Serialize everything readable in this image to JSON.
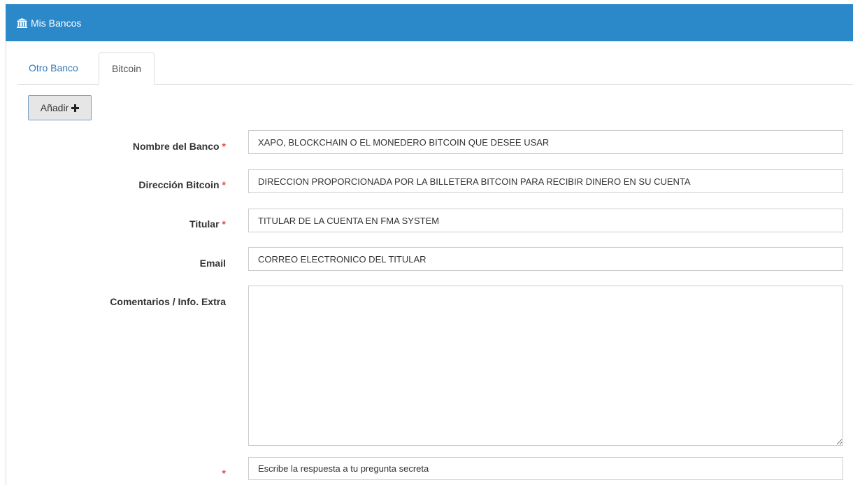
{
  "header": {
    "icon": "bank-icon",
    "title": "Mis Bancos"
  },
  "tabs": [
    {
      "label": "Otro Banco",
      "active": false
    },
    {
      "label": "Bitcoin",
      "active": true
    }
  ],
  "toolbar": {
    "add_label": "Añadir",
    "add_icon": "plus-icon"
  },
  "form": {
    "bank_name": {
      "label": "Nombre del Banco",
      "required": "*",
      "value": "XAPO, BLOCKCHAIN O EL MONEDERO BITCOIN QUE DESEE USAR"
    },
    "bitcoin_address": {
      "label": "Dirección Bitcoin",
      "required": "*",
      "value": "DIRECCION PROPORCIONADA POR LA BILLETERA BITCOIN PARA RECIBIR DINERO EN SU CUENTA"
    },
    "holder": {
      "label": "Titular",
      "required": "*",
      "value": "TITULAR DE LA CUENTA EN FMA SYSTEM"
    },
    "email": {
      "label": "Email",
      "value": "CORREO ELECTRONICO DEL TITULAR"
    },
    "comments": {
      "label": "Comentarios / Info. Extra",
      "value": ""
    },
    "secret_answer": {
      "required": "*",
      "placeholder": "Escribe la respuesta a tu pregunta secreta"
    }
  },
  "colors": {
    "header_bg": "#2b88c9",
    "link": "#337ab7",
    "required": "#d9534f"
  }
}
